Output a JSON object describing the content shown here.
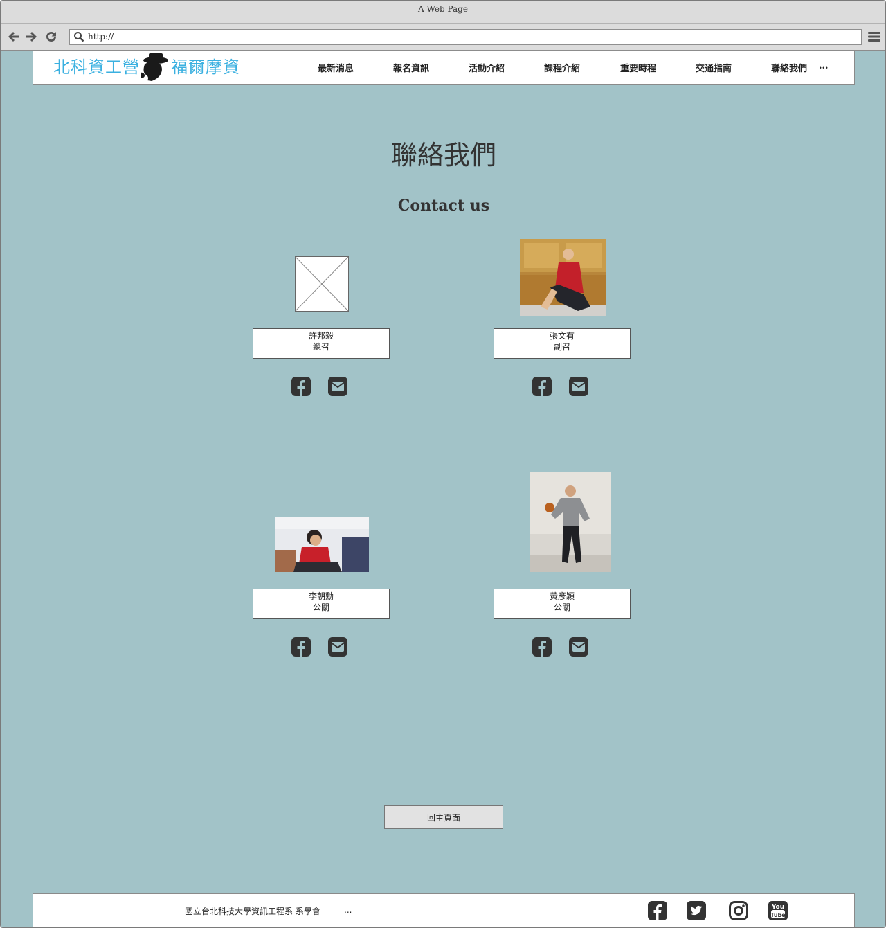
{
  "window": {
    "title": "A Web Page",
    "url": "http://"
  },
  "header": {
    "logo_text_left": "北科資工營",
    "logo_text_right": "福爾摩資",
    "nav": [
      "最新消息",
      "報名資訊",
      "活動介紹",
      "課程介紹",
      "重要時程",
      "交通指南",
      "聯絡我們"
    ],
    "nav_more": "..."
  },
  "main": {
    "title": "聯絡我們",
    "subtitle": "Contact us",
    "contacts": [
      {
        "name": "許邦毅",
        "role": "總召"
      },
      {
        "name": "張文有",
        "role": "副召"
      },
      {
        "name": "李朝勳",
        "role": "公關"
      },
      {
        "name": "黃彥穎",
        "role": "公關"
      }
    ],
    "home_button": "回主頁面"
  },
  "footer": {
    "text": "國立台北科技大學資訊工程系 系學會",
    "more": "...",
    "social": [
      "facebook-icon",
      "twitter-icon",
      "instagram-icon",
      "youtube-icon"
    ]
  },
  "colors": {
    "page_bg": "#a2c3c8",
    "icon": "#333333",
    "logo_blue": "#3ab0e0"
  }
}
